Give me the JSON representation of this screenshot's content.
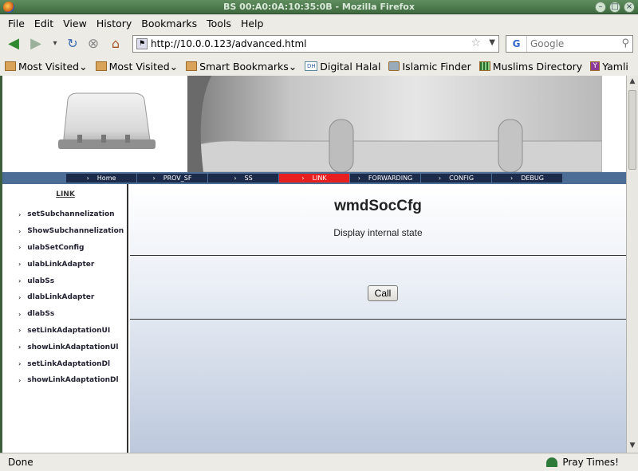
{
  "window": {
    "title": "BS 00:A0:0A:10:35:0B - Mozilla Firefox"
  },
  "menu": [
    "File",
    "Edit",
    "View",
    "History",
    "Bookmarks",
    "Tools",
    "Help"
  ],
  "navigation": {
    "url": "http://10.0.0.123/advanced.html",
    "search_engine": "G",
    "search_placeholder": "Google"
  },
  "bookmarks": [
    {
      "label": "Most Visited",
      "icon": "folder-icon",
      "dropdown": true
    },
    {
      "label": "Most Visited",
      "icon": "folder-icon",
      "dropdown": true
    },
    {
      "label": "Smart Bookmarks",
      "icon": "folder-icon",
      "dropdown": true
    },
    {
      "label": "Digital Halal",
      "icon": "digital-halal-icon",
      "dropdown": false
    },
    {
      "label": "Islamic Finder",
      "icon": "islamic-finder-icon",
      "dropdown": false
    },
    {
      "label": "Muslims Directory",
      "icon": "muslims-directory-icon",
      "dropdown": false
    },
    {
      "label": "Yamli",
      "icon": "yamli-icon",
      "dropdown": false
    }
  ],
  "page": {
    "nav_tabs": [
      {
        "label": "Home",
        "active": false
      },
      {
        "label": "PROV_SF",
        "active": false
      },
      {
        "label": "SS",
        "active": false
      },
      {
        "label": "LINK",
        "active": true
      },
      {
        "label": "FORWARDING",
        "active": false
      },
      {
        "label": "CONFIG",
        "active": false
      },
      {
        "label": "DEBUG",
        "active": false
      }
    ],
    "sidebar": {
      "heading": "LINK",
      "items": [
        "setSubchannelization",
        "ShowSubchannelization",
        "ulabSetConfig",
        "ulabLinkAdapter",
        "ulabSs",
        "dlabLinkAdapter",
        "dlabSs",
        "setLinkAdaptationUI",
        "showLinkAdaptationUl",
        "setLinkAdaptationDl",
        "showLinkAdaptationDl"
      ]
    },
    "main": {
      "function_name": "wmdSocCfg",
      "description": "Display internal state",
      "call_label": "Call"
    }
  },
  "status": {
    "text": "Done",
    "addon": "Pray Times!"
  },
  "colors": {
    "nav_strip": "#4b6d96",
    "nav_tab": "#1d2b4a",
    "nav_tab_active": "#e81f1f",
    "title_bar": "#4f7c4f"
  }
}
